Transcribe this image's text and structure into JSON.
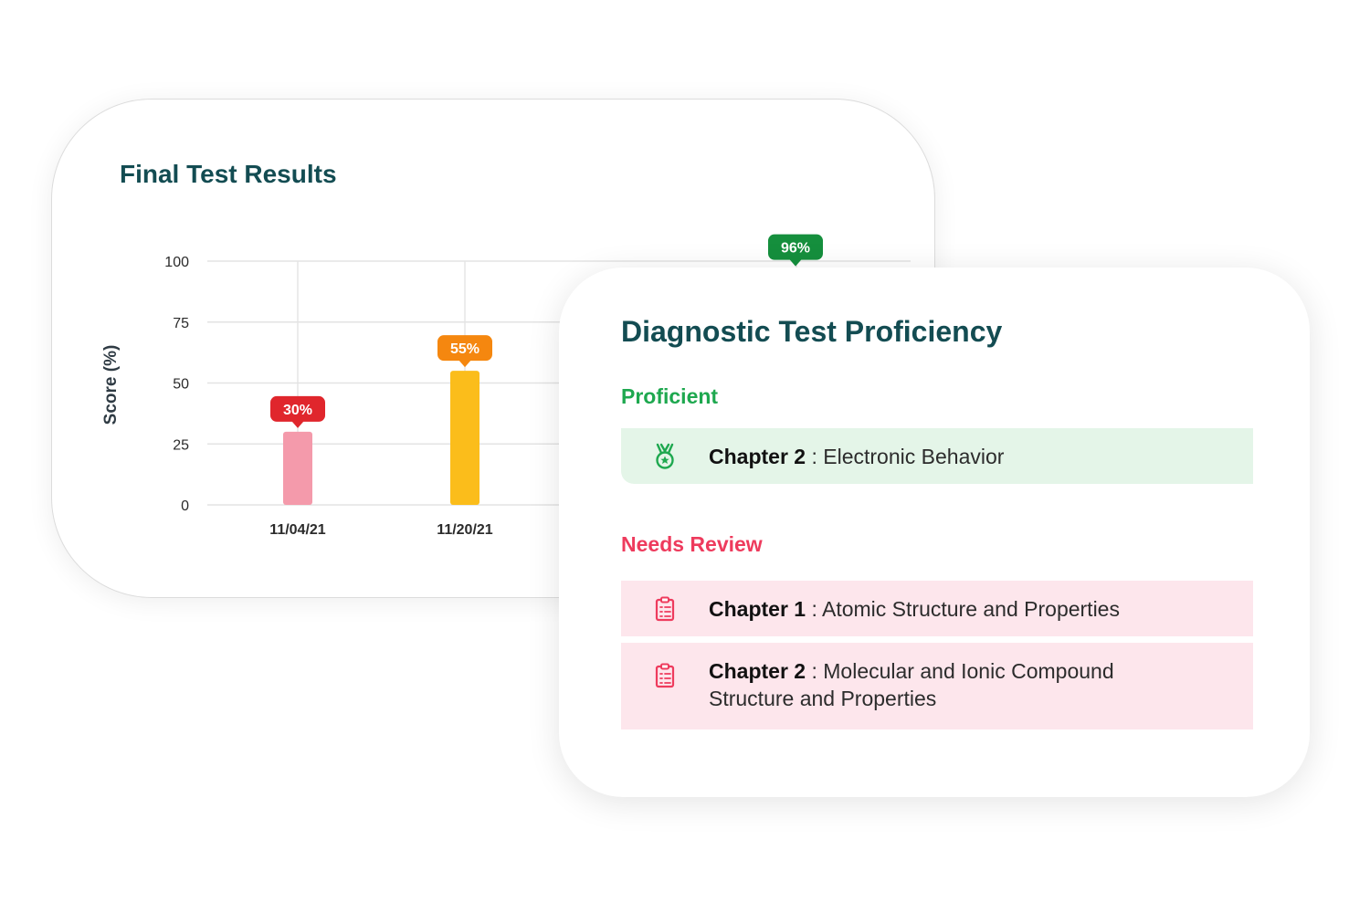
{
  "results_card": {
    "title": "Final Test Results"
  },
  "chart_data": {
    "type": "bar",
    "ylabel": "Score (%)",
    "ylim": [
      0,
      100
    ],
    "yticks": [
      "100",
      "75",
      "50",
      "25",
      "0"
    ],
    "categories": [
      "11/04/21",
      "11/20/21",
      ""
    ],
    "values": [
      30,
      55,
      96
    ],
    "data_labels": [
      "30%",
      "55%",
      "96%"
    ],
    "bar_colors": [
      "#f49aab",
      "#fbbd1b",
      ""
    ],
    "label_colors": [
      "#e0262c",
      "#f5870f",
      "#158f3d"
    ],
    "grid": true
  },
  "diagnostic_card": {
    "title": "Diagnostic Test Proficiency",
    "proficient_label": "Proficient",
    "needs_review_label": "Needs Review",
    "proficient_items": [
      {
        "chapter": "Chapter 2",
        "separator": " : ",
        "topic": "Electronic Behavior",
        "icon": "medal-icon"
      }
    ],
    "review_items": [
      {
        "chapter": "Chapter 1",
        "separator": " : ",
        "topic": "Atomic Structure and Properties",
        "icon": "clipboard-icon"
      },
      {
        "chapter": "Chapter 2",
        "separator": " : ",
        "topic": "Molecular and Ionic Compound Structure and Properties",
        "icon": "clipboard-icon"
      }
    ],
    "colors": {
      "title": "#134c52",
      "proficient": "#1ea84f",
      "needs_review": "#ee3b5d",
      "proficient_bg": "#e4f5e8",
      "review_bg": "#fde6ec"
    }
  }
}
